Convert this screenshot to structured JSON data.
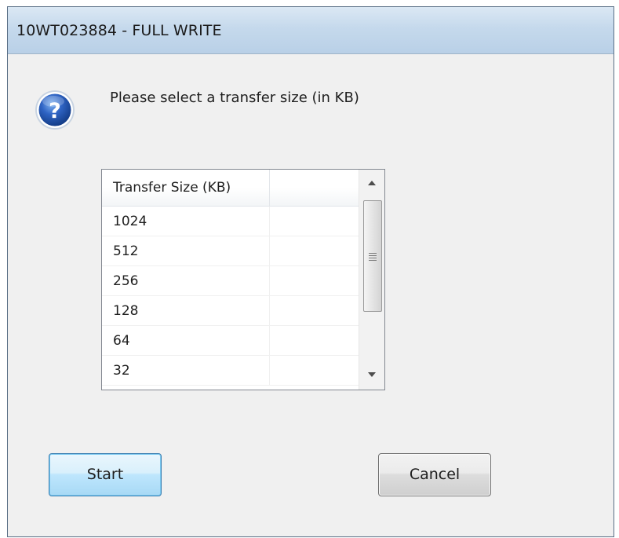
{
  "window": {
    "title": "10WT023884 - FULL WRITE"
  },
  "dialog": {
    "icon": "question-icon",
    "prompt": "Please select a transfer size (in KB)"
  },
  "list": {
    "columns": [
      "Transfer Size (KB)",
      ""
    ],
    "rows": [
      [
        "1024",
        ""
      ],
      [
        "512",
        ""
      ],
      [
        "256",
        ""
      ],
      [
        "128",
        ""
      ],
      [
        "64",
        ""
      ],
      [
        "32",
        ""
      ]
    ]
  },
  "buttons": {
    "start_label": "Start",
    "cancel_label": "Cancel"
  },
  "colors": {
    "title_bar": "#c5d9ec",
    "dialog_background": "#f0f0f0",
    "default_button_border": "#3c7fb1",
    "question_icon_blue": "#1f4e9a"
  }
}
